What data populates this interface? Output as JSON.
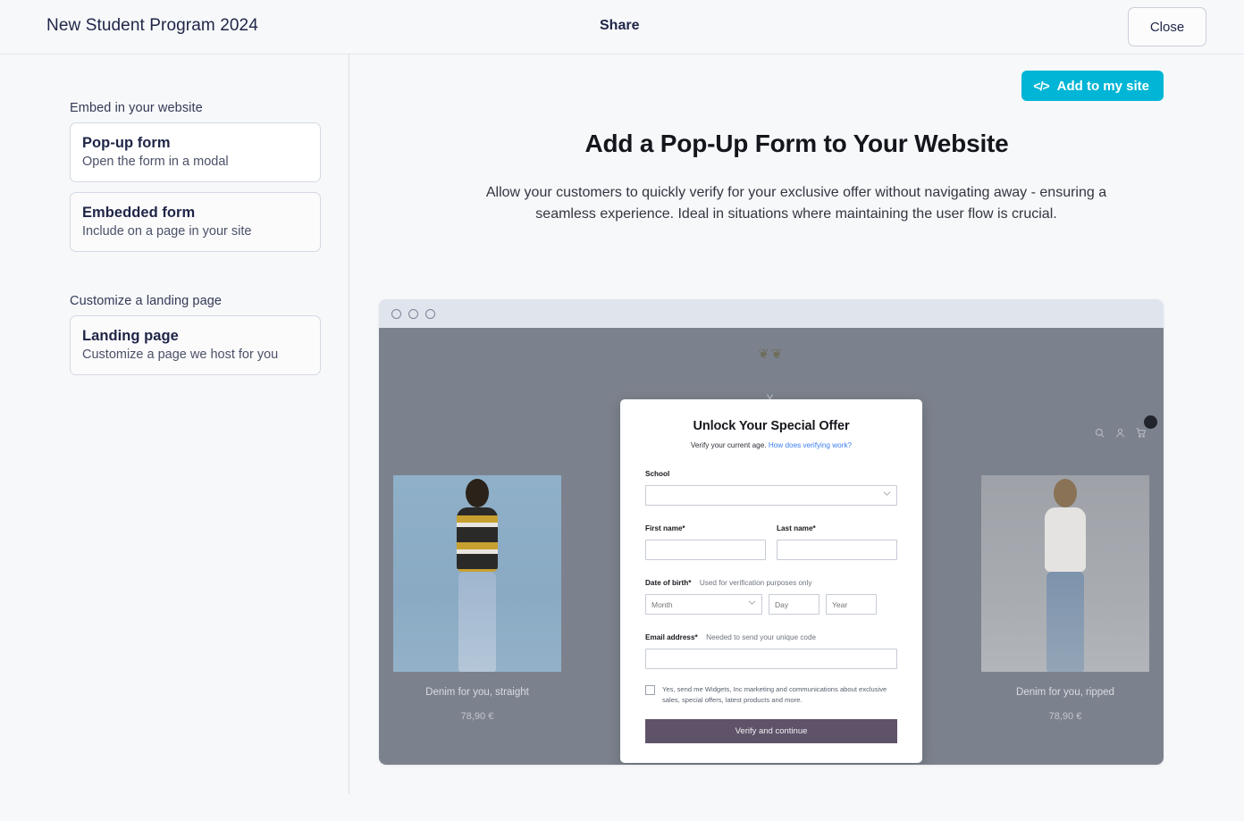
{
  "topbar": {
    "title": "New Student Program 2024",
    "center_label": "Share",
    "close_label": "Close"
  },
  "sidebar": {
    "sections": [
      {
        "label": "Embed in your website",
        "options": [
          {
            "title": "Pop-up form",
            "subtitle": "Open the form in a modal",
            "selected": true
          },
          {
            "title": "Embedded form",
            "subtitle": "Include on a page in your site",
            "selected": false
          }
        ]
      },
      {
        "label": "Customize a landing page",
        "options": [
          {
            "title": "Landing page",
            "subtitle": "Customize a page we host for you",
            "selected": false
          }
        ]
      }
    ]
  },
  "main": {
    "add_to_site_label": "Add to my site",
    "code_icon_glyph": "</>",
    "heading": "Add a Pop-Up Form to Your Website",
    "description": "Allow your customers to quickly verify for your exclusive offer without navigating away - ensuring a seamless experience. Ideal in situations where maintaining the user flow is crucial.",
    "accent_color": "#00b5d6"
  },
  "preview": {
    "store_logo": "❦❦",
    "store_nav": "Y",
    "icons": [
      "search-icon",
      "account-icon",
      "cart-icon"
    ],
    "products": [
      {
        "name": "Denim for you, straight",
        "price": "78,90 €"
      },
      {
        "name": "",
        "price": ""
      },
      {
        "name": "Denim for you, ripped",
        "price": "78,90 €"
      }
    ]
  },
  "popup_form": {
    "title": "Unlock Your Special Offer",
    "subtitle_text": "Verify your current age.",
    "subtitle_link": "How does verifying work?",
    "school": {
      "label": "School",
      "value": "",
      "placeholder": ""
    },
    "first_name": {
      "label": "First name*",
      "value": ""
    },
    "last_name": {
      "label": "Last name*",
      "value": ""
    },
    "dob": {
      "label": "Date of birth*",
      "hint": "Used for verification purposes only",
      "month_placeholder": "Month",
      "day_placeholder": "Day",
      "year_placeholder": "Year"
    },
    "email": {
      "label": "Email address*",
      "hint": "Needed to send your unique code",
      "value": ""
    },
    "consent_text": "Yes, send me Widgets, Inc marketing and communications about exclusive sales, special offers, latest products and more.",
    "submit_label": "Verify and continue",
    "submit_color": "#5f5369"
  }
}
